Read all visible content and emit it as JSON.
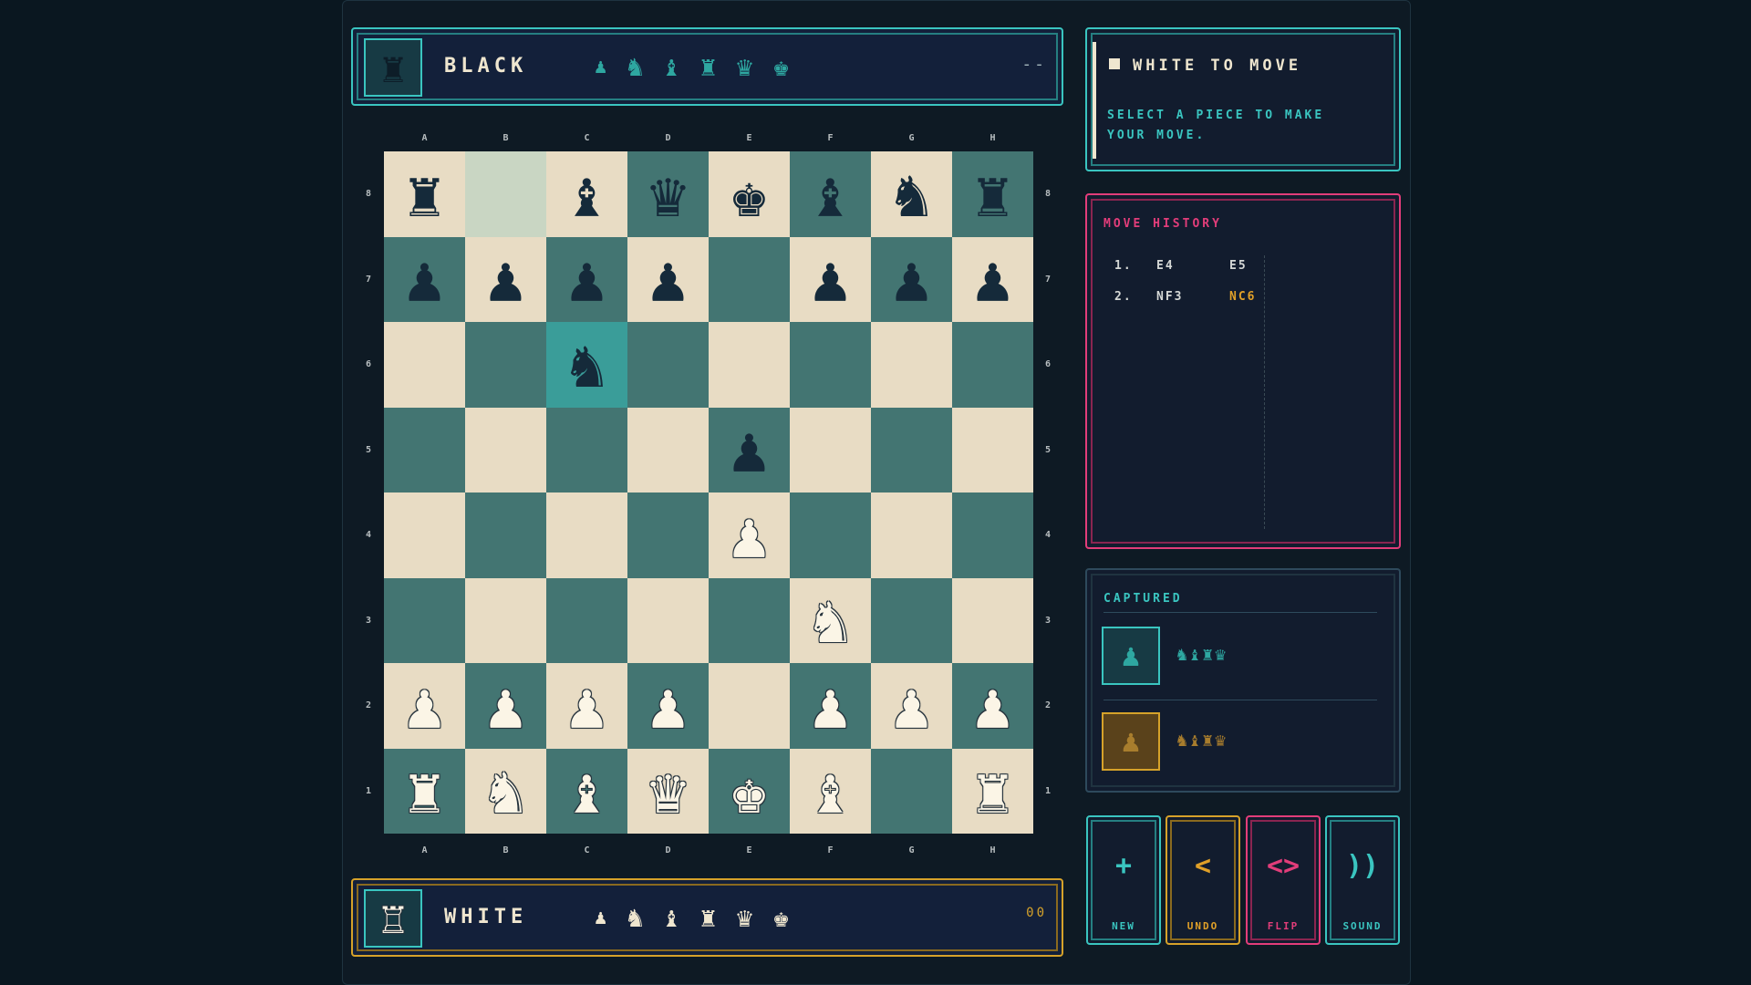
{
  "players": {
    "black": {
      "name": "BLACK",
      "avatar_piece": "♜",
      "captured_display": [
        "♟",
        "♞",
        "♝",
        "♜",
        "♛",
        "♚"
      ],
      "clock": "--"
    },
    "white": {
      "name": "WHITE",
      "avatar_piece": "♖",
      "captured_display": [
        "♟",
        "♞",
        "♝",
        "♜",
        "♛",
        "♚"
      ],
      "clock": "00"
    }
  },
  "board": {
    "files": [
      "A",
      "B",
      "C",
      "D",
      "E",
      "F",
      "G",
      "H"
    ],
    "ranks": [
      "8",
      "7",
      "6",
      "5",
      "4",
      "3",
      "2",
      "1"
    ],
    "rows": [
      [
        "br",
        "",
        "bb",
        "bq",
        "bk",
        "bb",
        "bn",
        "br"
      ],
      [
        "bp",
        "bp",
        "bp",
        "bp",
        "",
        "bp",
        "bp",
        "bp"
      ],
      [
        "",
        "",
        "bn",
        "",
        "",
        "",
        "",
        ""
      ],
      [
        "",
        "",
        "",
        "",
        "bp",
        "",
        "",
        ""
      ],
      [
        "",
        "",
        "",
        "",
        "wp",
        "",
        "",
        ""
      ],
      [
        "",
        "",
        "",
        "",
        "",
        "wn",
        "",
        ""
      ],
      [
        "wp",
        "wp",
        "wp",
        "wp",
        "",
        "wp",
        "wp",
        "wp"
      ],
      [
        "wr",
        "wn",
        "wb",
        "wq",
        "wk",
        "wb",
        "",
        "wr"
      ]
    ],
    "last_move_from": "b8",
    "last_move_to": "c6"
  },
  "status": {
    "title": "WHITE TO MOVE",
    "message": "SELECT A PIECE TO MAKE YOUR MOVE."
  },
  "history": {
    "title": "MOVE HISTORY",
    "moves": [
      {
        "num": "1.",
        "white": "E4",
        "black": "E5"
      },
      {
        "num": "2.",
        "white": "NF3",
        "black": "NC6"
      }
    ]
  },
  "captured": {
    "title": "CAPTURED",
    "rows": [
      {
        "icon": "♟",
        "pieces": "♞♝♜♛"
      },
      {
        "icon": "♟",
        "pieces": "♞♝♜♛"
      }
    ]
  },
  "buttons": {
    "new": {
      "icon": "+",
      "label": "NEW"
    },
    "undo": {
      "icon": "<",
      "label": "UNDO"
    },
    "flip": {
      "icon": "<>",
      "label": "FLIP"
    },
    "sound": {
      "icon": "))",
      "label": "SOUND"
    }
  },
  "colors": {
    "accent_teal": "#3ac5c0",
    "accent_gold": "#d6a22a",
    "accent_pink": "#e23d7a",
    "light_square": "#e8dcc4",
    "dark_square": "#437572"
  }
}
